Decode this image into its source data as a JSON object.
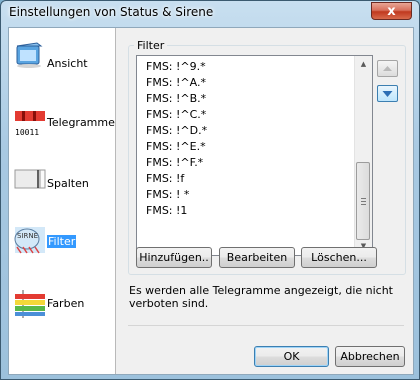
{
  "window": {
    "title": "Einstellungen von Status & Sirene",
    "close_label": "x"
  },
  "sidebar": {
    "items": [
      {
        "label": "Ansicht",
        "icon": "window-view-icon"
      },
      {
        "label": "Telegramme",
        "icon": "telegram-icon",
        "icon_text": "10011"
      },
      {
        "label": "Spalten",
        "icon": "columns-icon"
      },
      {
        "label": "Filter",
        "icon": "siren-filter-icon",
        "selected": true
      },
      {
        "label": "Farben",
        "icon": "colors-icon"
      }
    ]
  },
  "filter": {
    "group_title": "Filter",
    "items": [
      "FMS: !^9.*",
      "FMS: !^A.*",
      "FMS: !^B.*",
      "FMS: !^C.*",
      "FMS: !^D.*",
      "FMS: !^E.*",
      "FMS: !^F.*",
      "FMS: !f",
      "FMS: ! *",
      "FMS: !1"
    ],
    "buttons": {
      "add": "Hinzufügen..",
      "edit": "Bearbeiten",
      "delete": "Löschen..."
    },
    "description": "Es werden alle Telegramme angezeigt, die nicht verboten sind."
  },
  "footer": {
    "ok": "OK",
    "cancel": "Abbrechen"
  },
  "colors": {
    "selection": "#3399ff",
    "arrow_active": "#2d6fb5",
    "close_button": "#c0391f"
  }
}
